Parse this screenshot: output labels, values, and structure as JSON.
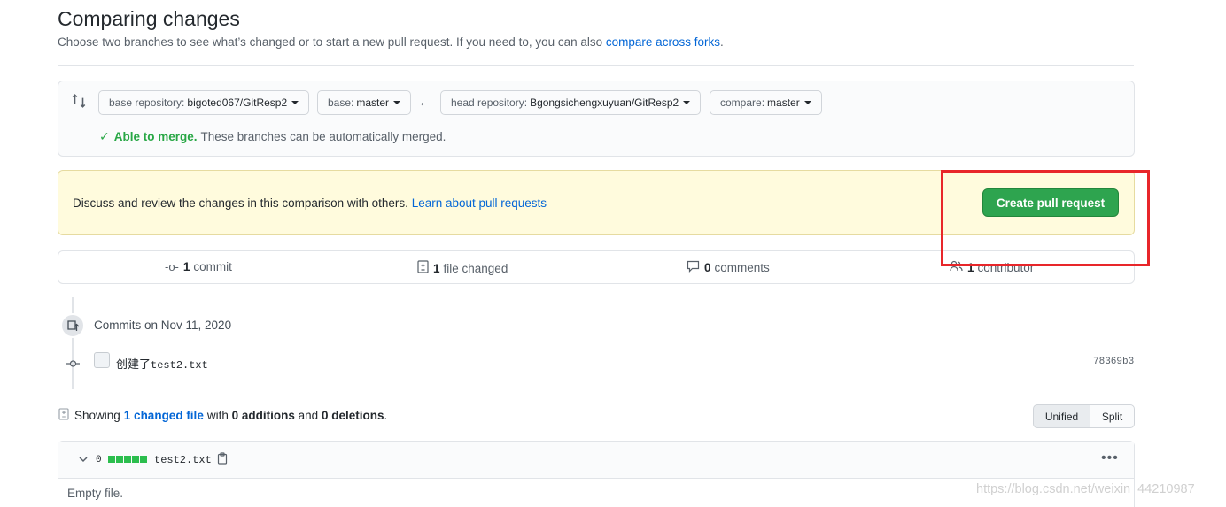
{
  "header": {
    "title": "Comparing changes",
    "subtitle": "Choose two branches to see what’s changed or to start a new pull request. If you need to, you can also",
    "subtitle_link": "compare across forks",
    "subtitle_end": "."
  },
  "range": {
    "base_repo_label": "base repository:",
    "base_repo_value": "bigoted067/GitResp2",
    "base_label": "base:",
    "base_value": "master",
    "head_repo_label": "head repository:",
    "head_repo_value": "Bgongsichengxuyuan/GitResp2",
    "compare_label": "compare:",
    "compare_value": "master",
    "arrow": "←",
    "merge_ok": "Able to merge.",
    "merge_text": "These branches can be automatically merged."
  },
  "flash": {
    "text": "Discuss and review the changes in this comparison with others.",
    "link": "Learn about pull requests",
    "create_button": "Create pull request"
  },
  "stats": {
    "commits_num": "1",
    "commits_label": "commit",
    "files_num": "1",
    "files_label": "file changed",
    "comments_num": "0",
    "comments_label": "comments",
    "contributors_num": "1",
    "contributors_label": "contributor"
  },
  "timeline": {
    "commits_on": "Commits on Nov 11, 2020",
    "commit_msg_prefix": "创建了",
    "commit_msg_file": "test2.txt",
    "sha": "78369b3"
  },
  "diff_summary": {
    "showing": "Showing",
    "changed_files_link": "1 changed file",
    "with": "with",
    "additions": "0 additions",
    "and": "and",
    "deletions": "0 deletions",
    "period": ".",
    "unified": "Unified",
    "split": "Split"
  },
  "file": {
    "count": "0",
    "name": "test2.txt",
    "empty": "Empty file."
  },
  "watermark": "https://blog.csdn.net/weixin_44210987",
  "colors": {
    "accent": "#0366d6",
    "success": "#2ea44f",
    "highlight_box": "#e8262a",
    "flash_bg": "#fffbdd"
  },
  "icons": [
    "compare-icon",
    "check-icon",
    "commit-icon",
    "file-diff-icon",
    "comment-icon",
    "people-icon",
    "repo-push-icon",
    "chevron-down-icon",
    "clipboard-icon",
    "kebab-icon"
  ]
}
